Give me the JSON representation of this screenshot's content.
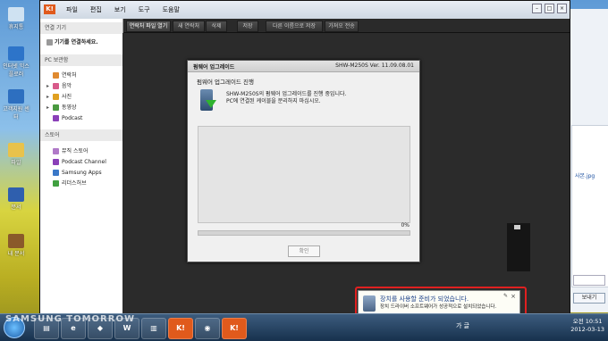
{
  "desktop": {
    "icons": [
      "휴지통",
      "인터넷 익스플로러",
      "고객지원 센터",
      "파일",
      "문서",
      "내 문서"
    ]
  },
  "app": {
    "menu": [
      "파일",
      "편집",
      "보기",
      "도구",
      "도움말"
    ],
    "toolbar": [
      "연락처 파일 열기",
      "새 연락처",
      "삭제",
      "저장",
      "다른 이름으로 저장",
      "가져오 전송"
    ],
    "sidebar": {
      "device_header": "연결 기기",
      "device_item": "기기를 연결하세요.",
      "pc_header": "PC 보관함",
      "pc_items": [
        "연락처",
        "음악",
        "사진",
        "동영상",
        "Podcast"
      ],
      "store_header": "스토어",
      "store_items": [
        "뮤직 스토어",
        "Podcast Channel",
        "Samsung Apps",
        "리더스허브"
      ]
    }
  },
  "dialog": {
    "title": "펌웨어 업그레이드",
    "model": "SHW-M250S Ver. 11.09.08.01",
    "subtitle": "펌웨어 업그레이드 진행",
    "message_line1": "SHW-M250S의 펌웨어 업그레이드를 진행 중입니다.",
    "message_line2": "PC에 연결된 케이블을 분리하지 마십시오.",
    "percent": "0%",
    "progress": 0,
    "ok_label": "확인"
  },
  "notification": {
    "title": "장치를 사용할 준비가 되었습니다.",
    "text": "장치 드라이버 소프트웨어가 성공적으로 설치되었습니다."
  },
  "background_window": {
    "filename": "사본.jpg",
    "send_label": "보내기"
  },
  "taskbar": {
    "watermark": "SAMSUNG TOMORROW",
    "clock_line1": "오전 10:51",
    "clock_line2": "2012-03-13",
    "tray_text": "가 글"
  },
  "colors": {
    "highlight": "#e02020",
    "titlebar_accent": "#e05a1c"
  }
}
